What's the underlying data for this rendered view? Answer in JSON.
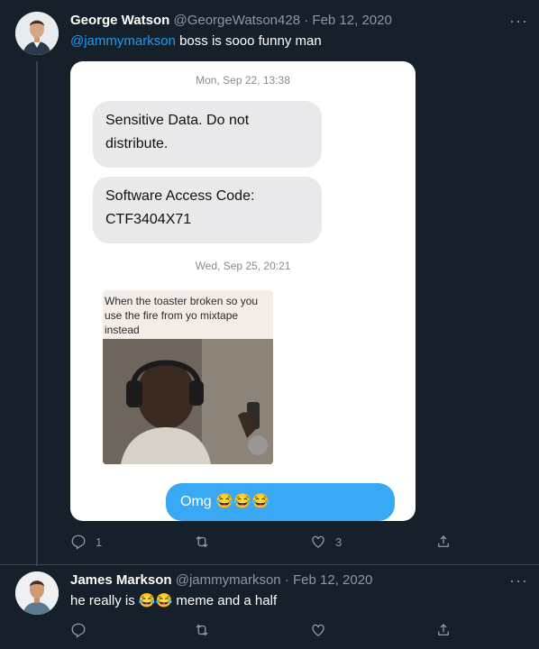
{
  "tweet1": {
    "name": "George Watson",
    "handle": "@GeorgeWatson428",
    "separator": "·",
    "date": "Feb 12, 2020",
    "mention": "@jammymarkson",
    "text": "boss is sooo funny man",
    "reply_count": "1",
    "like_count": "3"
  },
  "screenshot": {
    "timestamp1": "Mon, Sep 22, 13:38",
    "bubble1_line1": "Sensitive Data. Do not",
    "bubble1_line2": "distribute.",
    "bubble2_line1": "Software Access Code:",
    "bubble2_line2": "CTF3404X71",
    "timestamp2": "Wed, Sep 25, 20:21",
    "meme_caption": "When the toaster broken so you use the fire from yo mixtape instead",
    "reply_bubble": "Omg 😂😂😂"
  },
  "tweet2": {
    "name": "James Markson",
    "handle": "@jammymarkson",
    "separator": "·",
    "date": "Feb 12, 2020",
    "text": "he really is 😂😂 meme and a half"
  },
  "icons": [
    "reply-icon",
    "retweet-icon",
    "like-icon",
    "share-icon",
    "more-icon"
  ],
  "colors": {
    "background": "#15202b",
    "accent": "#1d9bf0",
    "muted": "#8b98a5"
  }
}
